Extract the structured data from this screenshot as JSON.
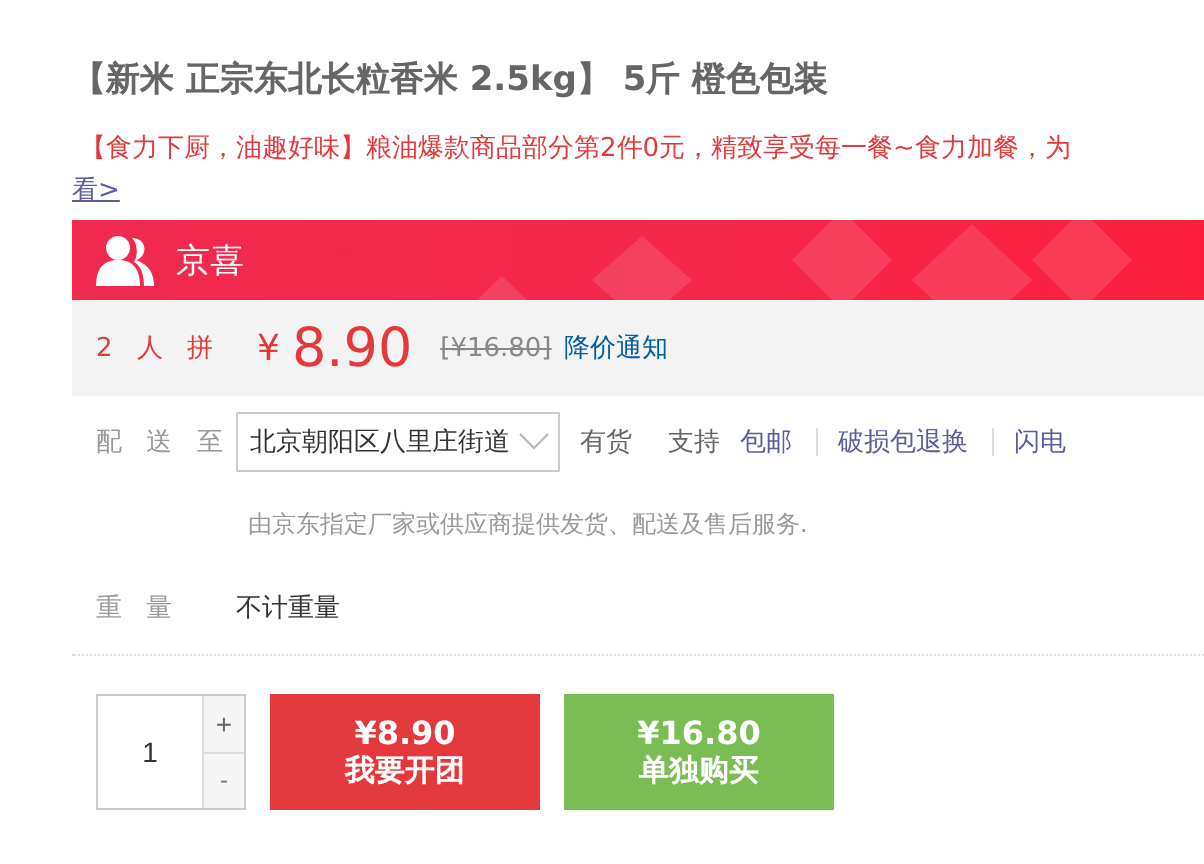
{
  "title": "【新米 正宗东北长粒香米 2.5kg】 5斤 橙色包装",
  "promo": {
    "text": "【食力下厨，油趣好味】粮油爆款商品部分第2件0元，精致享受每一餐~食力加餐，为",
    "link": "看>"
  },
  "banner": {
    "label": "京喜"
  },
  "price": {
    "group_label": "2 人 拼",
    "currency": "¥",
    "value": "8.90",
    "original": "[¥16.80]",
    "notify": "降价通知"
  },
  "delivery": {
    "label": "配 送 至",
    "location": "北京朝阳区八里庄街道",
    "stock": "有货",
    "support": "支持",
    "services": [
      "包邮",
      "破损包退换",
      "闪电"
    ]
  },
  "note": "由京东指定厂家或供应商提供发货、配送及售后服务.",
  "weight": {
    "label": "重 量",
    "value": "不计重量"
  },
  "quantity": {
    "value": "1",
    "plus": "+",
    "minus": "-"
  },
  "buttons": [
    {
      "kind": "group",
      "price": "¥8.90",
      "label": "我要开团"
    },
    {
      "kind": "single",
      "price": "¥16.80",
      "label": "单独购买"
    }
  ]
}
